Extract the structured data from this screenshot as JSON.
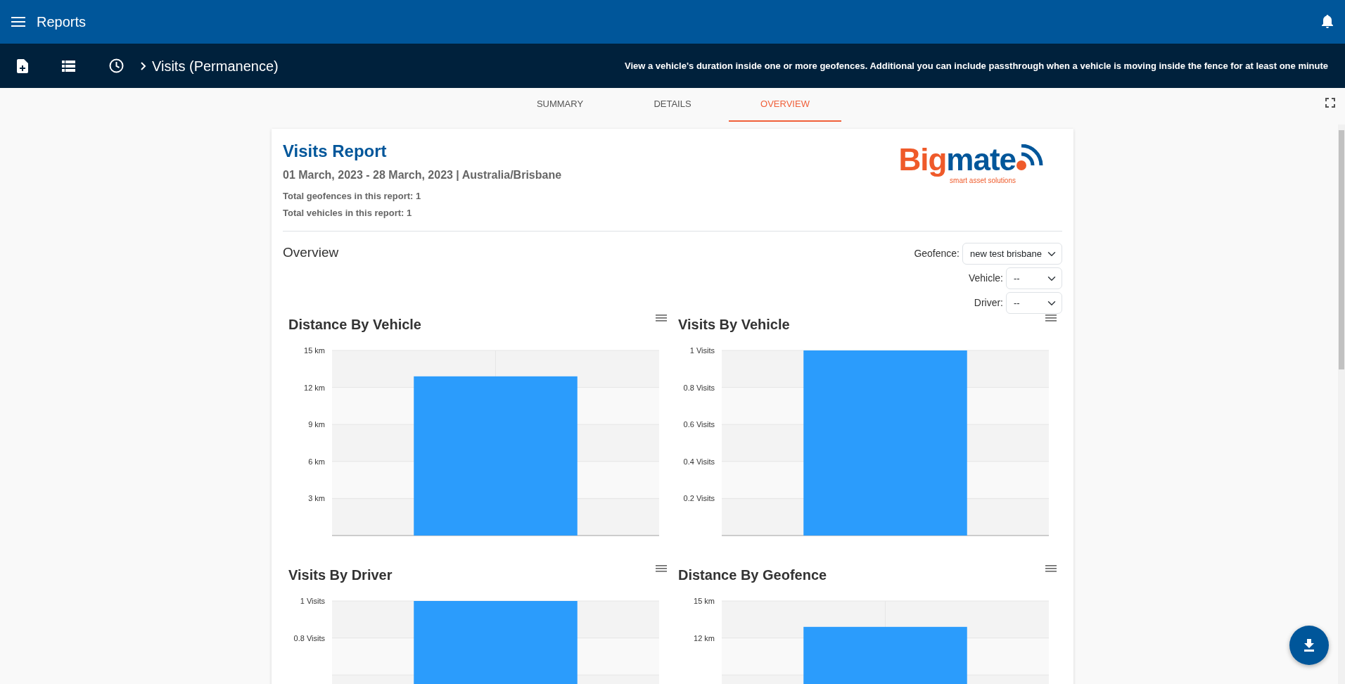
{
  "app_bar": {
    "title": "Reports"
  },
  "toolbar": {
    "breadcrumb": "Visits (Permanence)",
    "description": "View a vehicle's duration inside one or more geofences. Additional you can include passthrough when a vehicle is moving inside the fence for at least one minute"
  },
  "tabs": [
    {
      "label": "SUMMARY",
      "selected": false
    },
    {
      "label": "DETAILS",
      "selected": false
    },
    {
      "label": "OVERVIEW",
      "selected": true
    }
  ],
  "report": {
    "title": "Visits Report",
    "date_range": "01 March, 2023 - 28 March, 2023 | Australia/Brisbane",
    "totals": [
      "Total geofences in this report: 1",
      "Total vehicles in this report: 1"
    ],
    "logo": {
      "word_1": "Big",
      "word_2": "mate",
      "tagline": "smart asset solutions"
    },
    "section_title": "Overview",
    "filters": [
      {
        "label": "Geofence:",
        "value": "new test brisbane"
      },
      {
        "label": "Vehicle:",
        "value": "--"
      },
      {
        "label": "Driver:",
        "value": "--"
      }
    ],
    "charts": [
      {
        "title": "Distance By Vehicle",
        "chart_data": {
          "type": "bar",
          "values": [
            12.9
          ],
          "ylim": [
            0,
            15
          ],
          "grid": true,
          "yticks": [
            {
              "value": 3,
              "label": "3 km"
            },
            {
              "value": 6,
              "label": "6 km"
            },
            {
              "value": 9,
              "label": "9 km"
            },
            {
              "value": 12,
              "label": "12 km"
            },
            {
              "value": 15,
              "label": "15 km"
            }
          ]
        }
      },
      {
        "title": "Visits By Vehicle",
        "chart_data": {
          "type": "bar",
          "values": [
            1
          ],
          "ylim": [
            0,
            1
          ],
          "grid": true,
          "yticks": [
            {
              "value": 0.2,
              "label": "0.2 Visits"
            },
            {
              "value": 0.4,
              "label": "0.4 Visits"
            },
            {
              "value": 0.6,
              "label": "0.6 Visits"
            },
            {
              "value": 0.8,
              "label": "0.8 Visits"
            },
            {
              "value": 1,
              "label": "1 Visits"
            }
          ]
        }
      },
      {
        "title": "Visits By Driver",
        "chart_data": {
          "type": "bar",
          "values": [
            1
          ],
          "ylim": [
            0,
            1
          ],
          "grid": true,
          "yticks": [
            {
              "value": 0.8,
              "label": "0.8 Visits"
            },
            {
              "value": 1,
              "label": "1 Visits"
            }
          ]
        }
      },
      {
        "title": "Distance By Geofence",
        "chart_data": {
          "type": "bar",
          "values": [
            12.9
          ],
          "ylim": [
            0,
            15
          ],
          "grid": true,
          "yticks": [
            {
              "value": 12,
              "label": "12 km"
            },
            {
              "value": 15,
              "label": "15 km"
            }
          ]
        }
      }
    ]
  }
}
